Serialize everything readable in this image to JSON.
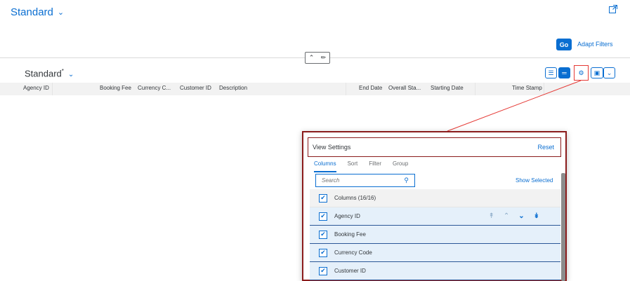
{
  "header": {
    "variant_title": "Standard",
    "chevron_icon": "chevron-down-icon",
    "export_icon": "share-icon",
    "go_label": "Go",
    "adapt_filters_label": "Adapt Filters"
  },
  "collapse_controls": {
    "collapse_icon": "chevron-up-icon",
    "pin_icon": "pin-icon"
  },
  "table": {
    "title": "Standard",
    "modified_marker": "*",
    "columns": [
      "Agency ID",
      "Booking Fee",
      "Currency C...",
      "Customer ID",
      "Description",
      "End Date",
      "Overall Sta...",
      "Starting Date",
      "Time Stamp"
    ],
    "toolbar_icons": [
      "show-details-icon",
      "hide-details-icon",
      "settings-icon",
      "export-icon",
      "dropdown-icon"
    ]
  },
  "dialog": {
    "title": "View Settings",
    "reset_label": "Reset",
    "tabs": [
      {
        "label": "Columns",
        "active": true
      },
      {
        "label": "Sort",
        "active": false
      },
      {
        "label": "Filter",
        "active": false
      },
      {
        "label": "Group",
        "active": false
      }
    ],
    "search_placeholder": "Search",
    "show_selected_label": "Show Selected",
    "select_all_label": "Columns (16/16)",
    "items": [
      {
        "label": "Agency ID",
        "checked": true,
        "show_arrows": true
      },
      {
        "label": "Booking Fee",
        "checked": true,
        "show_arrows": false
      },
      {
        "label": "Currency Code",
        "checked": true,
        "show_arrows": false
      },
      {
        "label": "Customer ID",
        "checked": true,
        "show_arrows": false
      }
    ]
  },
  "colors": {
    "accent": "#0a6ed1",
    "highlight_red": "#e53935",
    "dialog_border": "#8b1c1c"
  }
}
